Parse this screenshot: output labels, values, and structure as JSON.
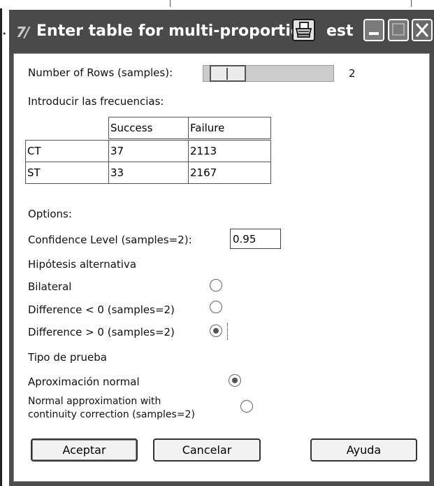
{
  "window": {
    "title": "Enter table for multi-proportio",
    "title_tail": "est"
  },
  "rows_slider": {
    "label": "Number of Rows (samples):",
    "value": "2"
  },
  "table": {
    "label": "Introducir las frecuencias:",
    "columns": [
      "Success",
      "Failure"
    ],
    "rows": [
      {
        "name": "CT",
        "success": "37",
        "failure": "2113"
      },
      {
        "name": "ST",
        "success": "33",
        "failure": "2167"
      }
    ]
  },
  "options": {
    "heading": "Options:",
    "confidence_label": "Confidence Level (samples=2):",
    "confidence_value": "0.95",
    "hypothesis_heading": "Hipótesis alternativa",
    "hypotheses": [
      {
        "label": "Bilateral",
        "checked": false
      },
      {
        "label": "Difference < 0 (samples=2)",
        "checked": false
      },
      {
        "label": "Difference > 0 (samples=2)",
        "checked": true
      }
    ],
    "test_heading": "Tipo de prueba",
    "tests": [
      {
        "label": "Aproximación normal",
        "checked": true
      },
      {
        "label_line1": "Normal approximation with",
        "label_line2": "continuity correction (samples=2)",
        "checked": false
      }
    ]
  },
  "buttons": {
    "accept": "Aceptar",
    "cancel": "Cancelar",
    "help": "Ayuda"
  },
  "icons": {
    "app": "app-logo-icon",
    "print": "printer-icon",
    "minimize": "minimize-icon",
    "maximize": "maximize-icon",
    "close": "close-icon"
  }
}
